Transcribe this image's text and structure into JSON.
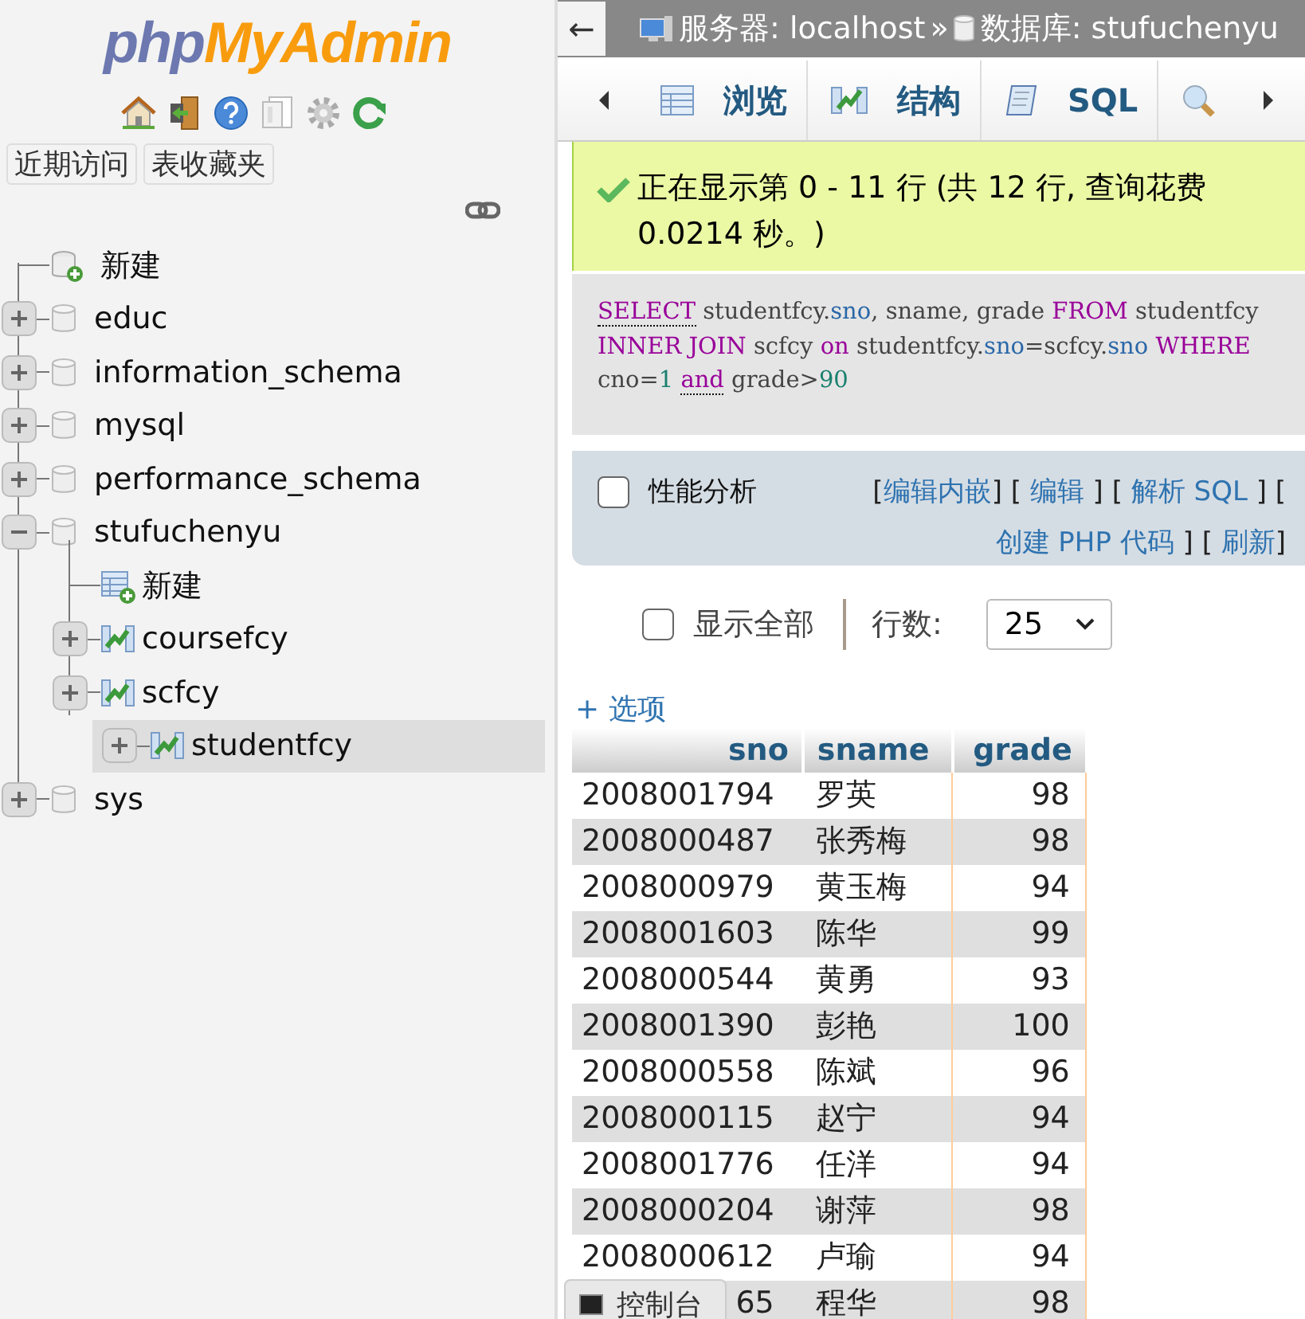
{
  "sidebar": {
    "logo": [
      {
        "text": "php",
        "color": "#6c78af"
      },
      {
        "text": "MyAdmin",
        "color": "#f89c0e"
      }
    ],
    "quick_tabs": [
      "近期访问",
      "表收藏夹"
    ],
    "tree": [
      {
        "kind": "new",
        "label": "新建"
      },
      {
        "kind": "database",
        "label": "educ",
        "expanded": false,
        "selected": false
      },
      {
        "kind": "database",
        "label": "information_schema",
        "expanded": false,
        "selected": false
      },
      {
        "kind": "database",
        "label": "mysql",
        "expanded": false,
        "selected": false
      },
      {
        "kind": "database",
        "label": "performance_schema",
        "expanded": false,
        "selected": false
      },
      {
        "kind": "database",
        "label": "stufuchenyu",
        "expanded": true,
        "selected": false,
        "children": [
          {
            "kind": "new",
            "label": "新建"
          },
          {
            "kind": "table",
            "label": "coursefcy",
            "expanded": false,
            "selected": false
          },
          {
            "kind": "table",
            "label": "scfcy",
            "expanded": false,
            "selected": false
          },
          {
            "kind": "table",
            "label": "studentfcy",
            "expanded": false,
            "selected": true
          }
        ]
      },
      {
        "kind": "database",
        "label": "sys",
        "expanded": false,
        "selected": false
      }
    ]
  },
  "breadcrumb": {
    "back": "←",
    "server": "服务器: localhost",
    "separator": "»",
    "database": "数据库: stufuchenyu"
  },
  "tabs": [
    {
      "label": "浏览",
      "selected": false
    },
    {
      "label": "结构",
      "selected": false
    },
    {
      "label": "SQL",
      "selected": false
    },
    {
      "selected": false
    }
  ],
  "message": "正在显示第 0 - 11 行 (共 12 行, 查询花费 0.0214 秒。)",
  "sql": [
    {
      "text": "SELECT",
      "kind": "keyword-doc"
    },
    {
      "text": " studentfcy.",
      "kind": "plain"
    },
    {
      "text": "sno",
      "kind": "identifier"
    },
    {
      "text": ", sname, grade ",
      "kind": "plain"
    },
    {
      "text": "FROM",
      "kind": "keyword"
    },
    {
      "text": " studentfcy ",
      "kind": "plain"
    },
    {
      "text": "INNER JOIN",
      "kind": "keyword"
    },
    {
      "text": " scfcy ",
      "kind": "plain"
    },
    {
      "text": "on",
      "kind": "keyword"
    },
    {
      "text": " studentfcy.",
      "kind": "plain"
    },
    {
      "text": "sno",
      "kind": "identifier"
    },
    {
      "text": "=scfcy.",
      "kind": "plain"
    },
    {
      "text": "sno",
      "kind": "identifier"
    },
    {
      "text": " WHERE",
      "kind": "keyword"
    },
    {
      "text": " cno=",
      "kind": "plain"
    },
    {
      "text": "1 ",
      "kind": "number"
    },
    {
      "text": "and",
      "kind": "keyword-doc"
    },
    {
      "text": " grade>",
      "kind": "plain"
    },
    {
      "text": "90",
      "kind": "number"
    }
  ],
  "query_actions": {
    "profiling": {
      "label": "性能分析",
      "checked": false
    },
    "parts": [
      {
        "kind": "text",
        "text": "["
      },
      {
        "kind": "link",
        "text": "编辑内嵌"
      },
      {
        "kind": "text",
        "text": "] [ "
      },
      {
        "kind": "link",
        "text": "编辑"
      },
      {
        "kind": "text",
        "text": " ] [ "
      },
      {
        "kind": "link",
        "text": "解析 SQL"
      },
      {
        "kind": "text",
        "text": " ] [ "
      },
      {
        "kind": "link",
        "text": "创建 PHP 代码"
      },
      {
        "kind": "text",
        "text": " ] [ "
      },
      {
        "kind": "link",
        "text": "刷新"
      },
      {
        "kind": "text",
        "text": "]"
      }
    ]
  },
  "navigation": {
    "show_all": {
      "label": "显示全部",
      "checked": false
    },
    "rows_label": "行数:",
    "rows_value": "25"
  },
  "options_link": "+ 选项",
  "table": {
    "columns": [
      "sno",
      "sname",
      "grade"
    ],
    "rows": [
      [
        "2008001794",
        "罗英",
        "98"
      ],
      [
        "2008000487",
        "张秀梅",
        "98"
      ],
      [
        "2008000979",
        "黄玉梅",
        "94"
      ],
      [
        "2008001603",
        "陈华",
        "99"
      ],
      [
        "2008000544",
        "黄勇",
        "93"
      ],
      [
        "2008001390",
        "彭艳",
        "100"
      ],
      [
        "2008000558",
        "陈斌",
        "96"
      ],
      [
        "2008000115",
        "赵宁",
        "94"
      ],
      [
        "2008001776",
        "任洋",
        "94"
      ],
      [
        "2008000204",
        "谢萍",
        "98"
      ],
      [
        "2008000612",
        "卢瑜",
        "94"
      ],
      [
        "65",
        "程华",
        "98"
      ]
    ]
  },
  "console_tab": "控制台"
}
